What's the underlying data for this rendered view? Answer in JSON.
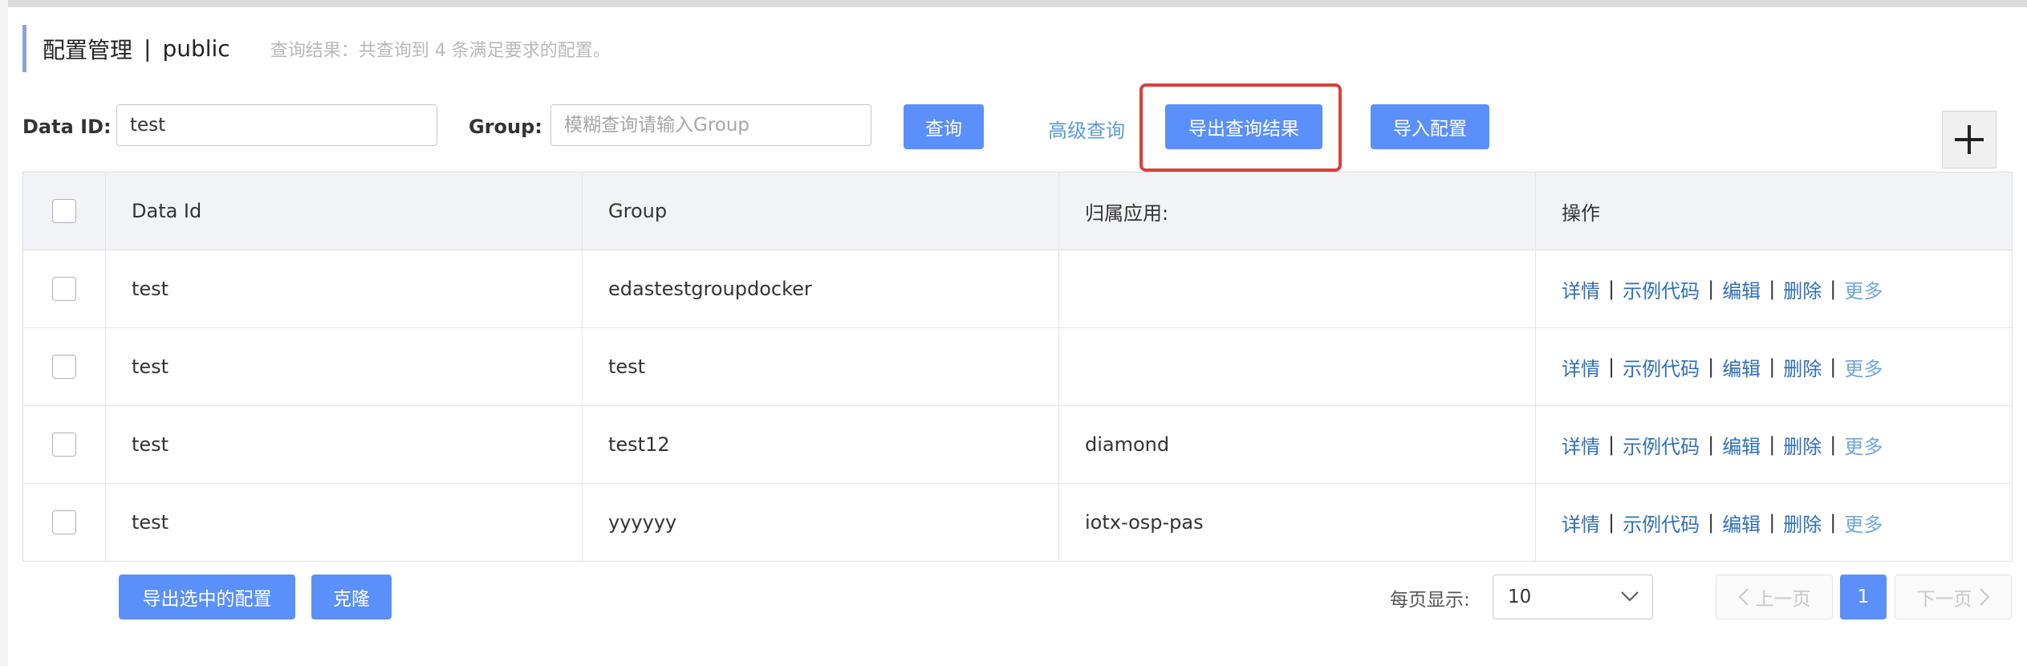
{
  "header": {
    "title": "配置管理",
    "separator": "|",
    "namespace": "public",
    "result_text": "查询结果：共查询到 4 条满足要求的配置。"
  },
  "search": {
    "data_id_label": "Data ID:",
    "data_id_value": "test",
    "group_label": "Group:",
    "group_placeholder": "模糊查询请输入Group",
    "query_button": "查询",
    "advanced_query": "高级查询",
    "export_query_button": "导出查询结果",
    "import_button": "导入配置",
    "add_icon": "plus-icon"
  },
  "table": {
    "columns": [
      "Data Id",
      "Group",
      "归属应用:",
      "操作"
    ],
    "rows": [
      {
        "data_id": "test",
        "group": "edastestgroupdocker",
        "app": ""
      },
      {
        "data_id": "test",
        "group": "test",
        "app": ""
      },
      {
        "data_id": "test",
        "group": "test12",
        "app": "diamond"
      },
      {
        "data_id": "test",
        "group": "yyyyyy",
        "app": "iotx-osp-pas"
      }
    ],
    "actions": {
      "detail": "详情",
      "sample_code": "示例代码",
      "edit": "编辑",
      "delete": "删除",
      "more": "更多",
      "separator": "|"
    }
  },
  "footer": {
    "export_selected_button": "导出选中的配置",
    "clone_button": "克隆",
    "page_size_label": "每页显示:",
    "page_size_value": "10",
    "prev_page": "上一页",
    "current_page": "1",
    "next_page": "下一页"
  },
  "colors": {
    "primary": "#5b8ff9",
    "link": "#2f6fb8",
    "highlight_border": "#d9403a"
  }
}
